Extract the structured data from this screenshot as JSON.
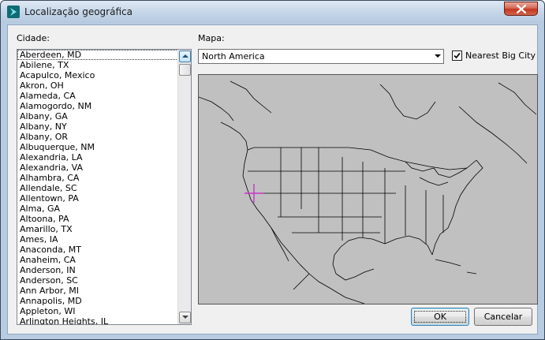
{
  "window": {
    "title": "Localização geográfica"
  },
  "city": {
    "label": "Cidade:",
    "items": [
      "Aberdeen, MD",
      "Abilene, TX",
      "Acapulco, Mexico",
      "Akron, OH",
      "Alameda, CA",
      "Alamogordo, NM",
      "Albany, GA",
      "Albany, NY",
      "Albany, OR",
      "Albuquerque, NM",
      "Alexandria, LA",
      "Alexandria, VA",
      "Alhambra, CA",
      "Allendale, SC",
      "Allentown, PA",
      "Alma, GA",
      "Altoona, PA",
      "Amarillo, TX",
      "Ames, IA",
      "Anaconda, MT",
      "Anaheim, CA",
      "Anderson, IN",
      "Anderson, SC",
      "Ann Arbor, MI",
      "Annapolis, MD",
      "Appleton, WI",
      "Arlington Heights, IL"
    ],
    "selected": "Aberdeen, MD"
  },
  "map": {
    "label": "Mapa:",
    "selected": "North America",
    "nearest_big_city_label": "Nearest Big City",
    "nearest_big_city_checked": true,
    "marker_color": "#cc33cc"
  },
  "buttons": {
    "ok": "OK",
    "cancel": "Cancelar"
  }
}
